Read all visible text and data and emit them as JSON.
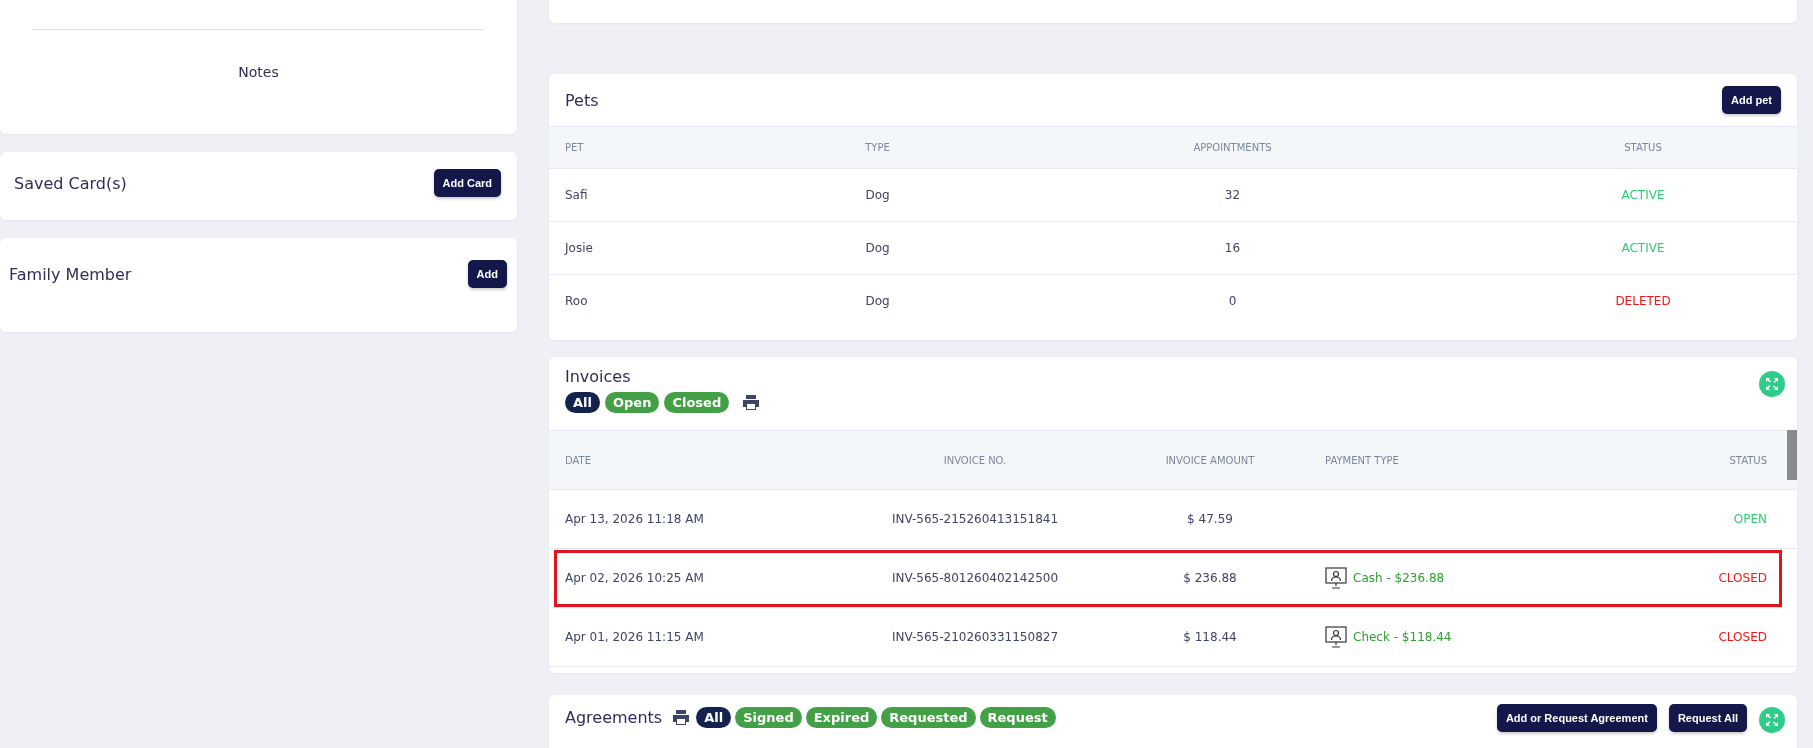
{
  "notes": {
    "label": "Notes"
  },
  "saved_cards": {
    "title": "Saved Card(s)",
    "button": "Add Card"
  },
  "family_member": {
    "title": "Family Member",
    "button": "Add"
  },
  "pets": {
    "title": "Pets",
    "button": "Add pet",
    "columns": [
      "PET",
      "TYPE",
      "APPOINTMENTS",
      "STATUS"
    ],
    "rows": [
      {
        "pet": "Safi",
        "type": "Dog",
        "appointments": "32",
        "status": "ACTIVE",
        "color": "#2ecc71"
      },
      {
        "pet": "Josie",
        "type": "Dog",
        "appointments": "16",
        "status": "ACTIVE",
        "color": "#2ecc71"
      },
      {
        "pet": "Roo",
        "type": "Dog",
        "appointments": "0",
        "status": "DELETED",
        "color": "#f01818"
      }
    ]
  },
  "invoices": {
    "title": "Invoices",
    "filters": [
      {
        "label": "All",
        "selected": true
      },
      {
        "label": "Open",
        "selected": false
      },
      {
        "label": "Closed",
        "selected": false
      }
    ],
    "columns": [
      "DATE",
      "INVOICE NO.",
      "INVOICE AMOUNT",
      "PAYMENT TYPE",
      "STATUS"
    ],
    "rows": [
      {
        "date": "Apr 13, 2026 11:18 AM",
        "invoice_no": "INV-565-215260413151841",
        "amount": "$ 47.59",
        "status": "OPEN",
        "color": "#2ecc71",
        "highlighted": false
      },
      {
        "date": "Apr 02, 2026 10:25 AM",
        "invoice_no": "INV-565-801260402142500",
        "amount": "$ 236.88",
        "payment": "Cash - $236.88",
        "status": "CLOSED",
        "color": "#f01818",
        "highlighted": true
      },
      {
        "date": "Apr 01, 2026 11:15 AM",
        "invoice_no": "INV-565-210260331150827",
        "amount": "$ 118.44",
        "payment": "Check - $118.44",
        "status": "CLOSED",
        "color": "#f01818",
        "highlighted": false
      }
    ]
  },
  "agreements": {
    "title": "Agreements",
    "filters": [
      {
        "label": "All",
        "selected": true
      },
      {
        "label": "Signed",
        "selected": false
      },
      {
        "label": "Expired",
        "selected": false
      },
      {
        "label": "Requested",
        "selected": false
      },
      {
        "label": "Request",
        "selected": false
      }
    ],
    "buttons": [
      "Add or Request Agreement",
      "Request All"
    ]
  }
}
